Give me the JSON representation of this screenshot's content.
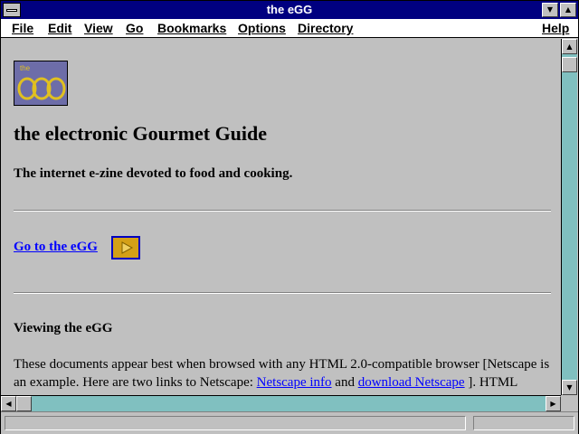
{
  "window": {
    "title": "the eGG"
  },
  "menu": {
    "file": "File",
    "edit": "Edit",
    "view": "View",
    "go": "Go",
    "bookmarks": "Bookmarks",
    "options": "Options",
    "directory": "Directory",
    "help": "Help"
  },
  "page": {
    "logo_text": "the egg",
    "heading": "the electronic Gourmet Guide",
    "subheading": "The internet e-zine devoted to food and cooking.",
    "go_link": "Go to the eGG",
    "section_title": "Viewing the eGG",
    "para_1": "These documents appear best when browsed with any HTML 2.0-compatible browser [Netscape is an example. Here are two links to Netscape: ",
    "link_netscape_info": "Netscape info",
    "para_and": " and ",
    "link_download": "download Netscape",
    "para_2": " ]. HTML"
  },
  "colors": {
    "titlebar": "#000080",
    "background": "#c0c0c0",
    "link": "#0000ff",
    "scroll_track": "#80c0c0"
  },
  "icons": {
    "system_menu": "minus-bar-icon",
    "minimize": "down-triangle-icon",
    "maximize": "up-triangle-icon"
  }
}
